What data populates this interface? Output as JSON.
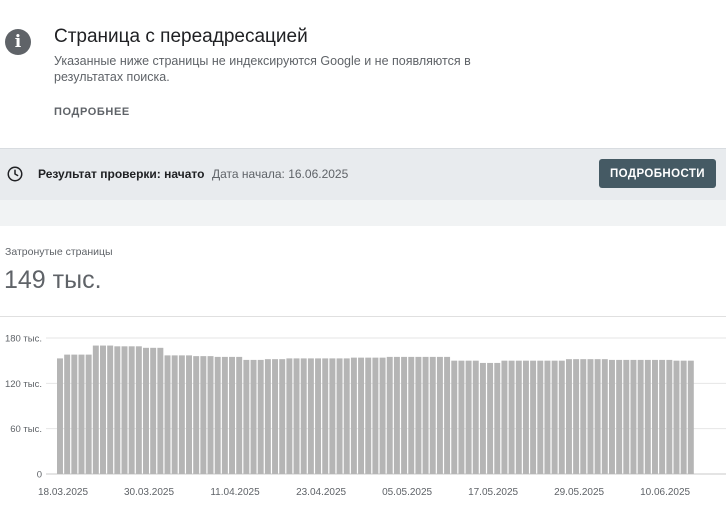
{
  "info": {
    "icon": "info-icon",
    "title": "Страница с переадресацией",
    "description": "Указанные ниже страницы не индексируются Google и не появляются в результатах поиска.",
    "more_link": "ПОДРОБНЕЕ"
  },
  "status": {
    "icon": "clock-icon",
    "label": "Результат проверки: начато",
    "date": "Дата начала: 16.06.2025",
    "button": "ПОДРОБНОСТИ"
  },
  "metric": {
    "label": "Затронутые страницы",
    "value": "149 тыс."
  },
  "colors": {
    "bar": "#b5b5b5",
    "button_bg": "#455a64",
    "status_bg": "#e8ebee"
  },
  "chart_data": {
    "type": "bar",
    "ylim": [
      0,
      180000
    ],
    "y_ticks": [
      {
        "value": 180000,
        "label": "180 тыс."
      },
      {
        "value": 120000,
        "label": "120 тыс."
      },
      {
        "value": 60000,
        "label": "60 тыс."
      },
      {
        "value": 0,
        "label": "0"
      }
    ],
    "x_tick_labels": [
      "18.03.2025",
      "30.03.2025",
      "11.04.2025",
      "23.04.2025",
      "05.05.2025",
      "17.05.2025",
      "29.05.2025",
      "10.06.2025"
    ],
    "x_tick_bar_index": [
      0,
      12,
      24,
      36,
      48,
      60,
      72,
      84
    ],
    "grid": true,
    "values": [
      153000,
      158000,
      158000,
      158000,
      158000,
      170000,
      170000,
      170000,
      169000,
      169000,
      169000,
      169000,
      167000,
      167000,
      167000,
      157000,
      157000,
      157000,
      157000,
      156000,
      156000,
      156000,
      155000,
      155000,
      155000,
      155000,
      151000,
      151000,
      151000,
      152000,
      152000,
      152000,
      153000,
      153000,
      153000,
      153000,
      153000,
      153000,
      153000,
      153000,
      153000,
      154000,
      154000,
      154000,
      154000,
      154000,
      155000,
      155000,
      155000,
      155000,
      155000,
      155000,
      155000,
      155000,
      155000,
      150000,
      150000,
      150000,
      150000,
      147000,
      147000,
      147000,
      150000,
      150000,
      150000,
      150000,
      150000,
      150000,
      150000,
      150000,
      150000,
      152000,
      152000,
      152000,
      152000,
      152000,
      152000,
      151000,
      151000,
      151000,
      151000,
      151000,
      151000,
      151000,
      151000,
      151000,
      150000,
      150000,
      150000
    ]
  }
}
